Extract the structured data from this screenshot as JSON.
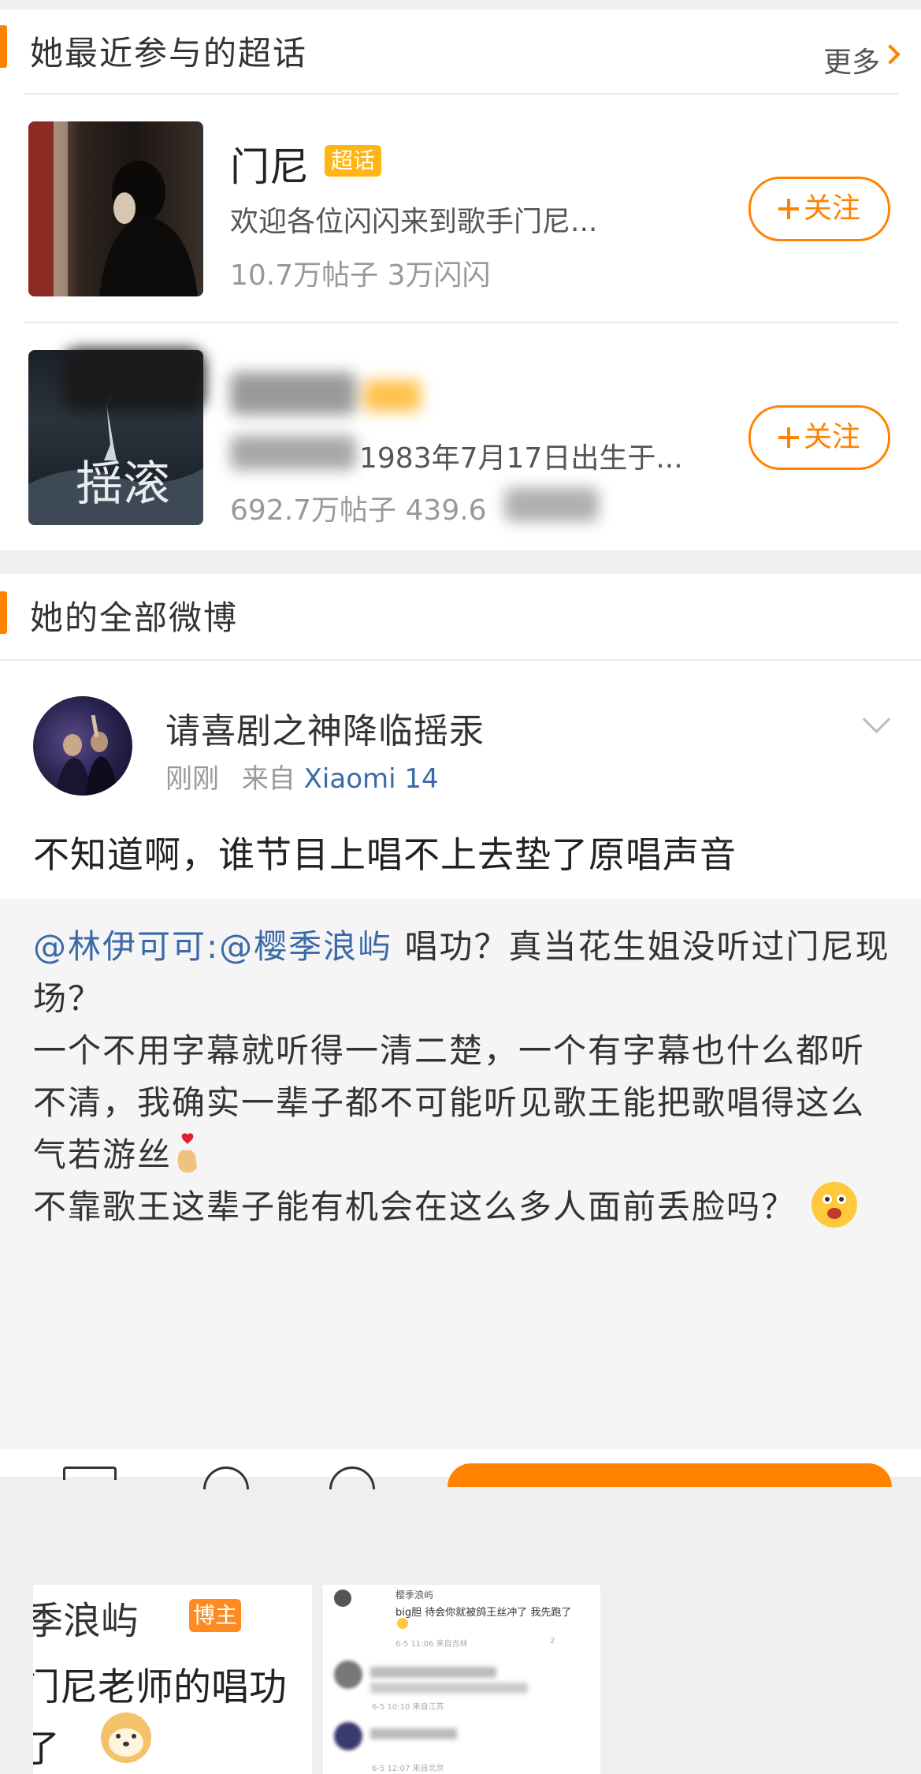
{
  "supertopics": {
    "title": "她最近参与的超话",
    "more_label": "更多",
    "items": [
      {
        "name": "门尼",
        "badge": "超话",
        "desc": "欢迎各位闪闪来到歌手门尼...",
        "stats": "10.7万帖子 3万闪闪",
        "follow_label": "关注"
      },
      {
        "name": "",
        "badge": "",
        "desc": "1983年7月17日出生于...",
        "stats": "692.7万帖子 439.6",
        "follow_label": "关注",
        "cover_text": "揺滚"
      }
    ]
  },
  "weibo": {
    "title": "她的全部微博",
    "post": {
      "username": "请喜剧之神降临摇汞",
      "time": "刚刚",
      "from_label": "来自",
      "source": "Xiaomi 14",
      "text": "不知道啊，谁节目上唱不上去垫了原唱声音",
      "repost": {
        "mention1": "@林伊可可",
        "mention2": ":@樱季浪屿",
        "line1": " 唱功？真当花生姐没听过门尼现场？",
        "line2": "一个不用字幕就听得一清二楚，一个有字幕也什么都听不清，我确实一辈子都不可能听见歌王能把歌唱得这么气若游丝",
        "line3": "不靠歌王这辈子能有机会在这么多人面前丢脸吗？",
        "image1": {
          "name_text": "季浪屿",
          "badge": "博主",
          "line1": "门尼老师的唱功",
          "line2": "了"
        },
        "image2": {
          "author": "樱季浪屿",
          "text": "big胆 待会你就被鸽王丝冲了 我先跑了",
          "meta1": "6-5 11:06 来自吉林",
          "meta2": "6-5 10:10 来自江苏",
          "meta3": "6-5 12:07 来自北京",
          "likes": "2"
        }
      }
    }
  },
  "colors": {
    "accent": "#ff8200",
    "link": "#3a6aa8",
    "badge": "#ffb514"
  }
}
